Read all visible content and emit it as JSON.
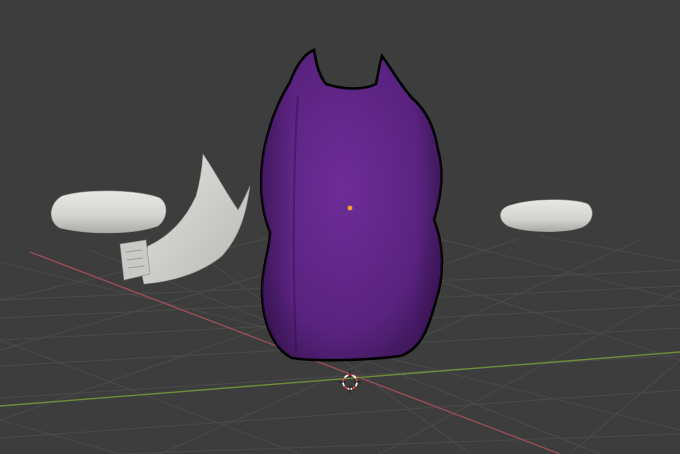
{
  "app": {
    "view": "3D Viewport"
  },
  "colors": {
    "background": "#3d3d3d",
    "grid_line": "#4a4a4a",
    "x_axis": "#9a4d55",
    "y_axis": "#6e8c3c",
    "body_fill": "#5e2585",
    "body_outline": "#000000",
    "clay_fill": "#d6d7d2",
    "origin_dot": "#f2a332",
    "cursor_ring_red": "#d04a4a",
    "cursor_ring_white": "#ffffff"
  },
  "scene": {
    "objects": [
      {
        "name": "purple-body-mesh",
        "selected": true,
        "material": "purple"
      },
      {
        "name": "left-arm-mesh",
        "selected": false,
        "material": "clay"
      },
      {
        "name": "right-arm-mesh",
        "selected": false,
        "material": "clay"
      },
      {
        "name": "wing-mesh",
        "selected": false,
        "material": "clay"
      }
    ],
    "cursor": {
      "icon": "3d-cursor-icon"
    },
    "origin": {
      "icon": "object-origin-icon"
    }
  }
}
